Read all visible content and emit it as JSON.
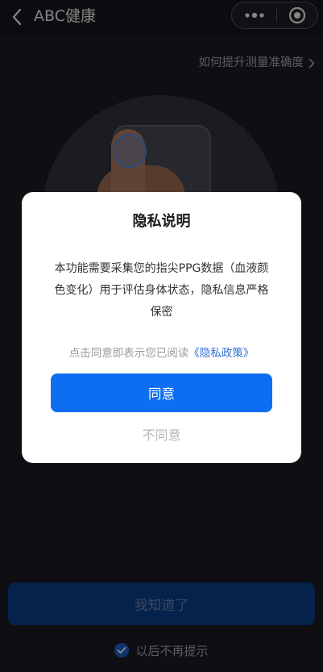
{
  "navbar": {
    "title": "ABC健康",
    "back_icon": "chevron-left-icon",
    "more_icon": "more-dots-icon",
    "close_icon": "target-circle-icon"
  },
  "main": {
    "tips_link": "如何提升测量准确度",
    "tips_icon": "chevron-right-icon",
    "primary_button": "我知道了",
    "remember_label": "以后不再提示",
    "remember_checked": true
  },
  "dialog": {
    "title": "隐私说明",
    "body_lines": [
      "本功能需要采集您的指尖PPG数据（血液颜",
      "色变化）用于评估身体状态，隐私信息严格",
      "保密"
    ],
    "notice_prefix": "点击同意即表示您已阅读",
    "policy_link": "《隐私政策》",
    "agree_button": "同意",
    "disagree_button": "不同意"
  },
  "colors": {
    "background": "#1a1b23",
    "accent": "#0c6ef0",
    "link": "#2f6fd6"
  }
}
